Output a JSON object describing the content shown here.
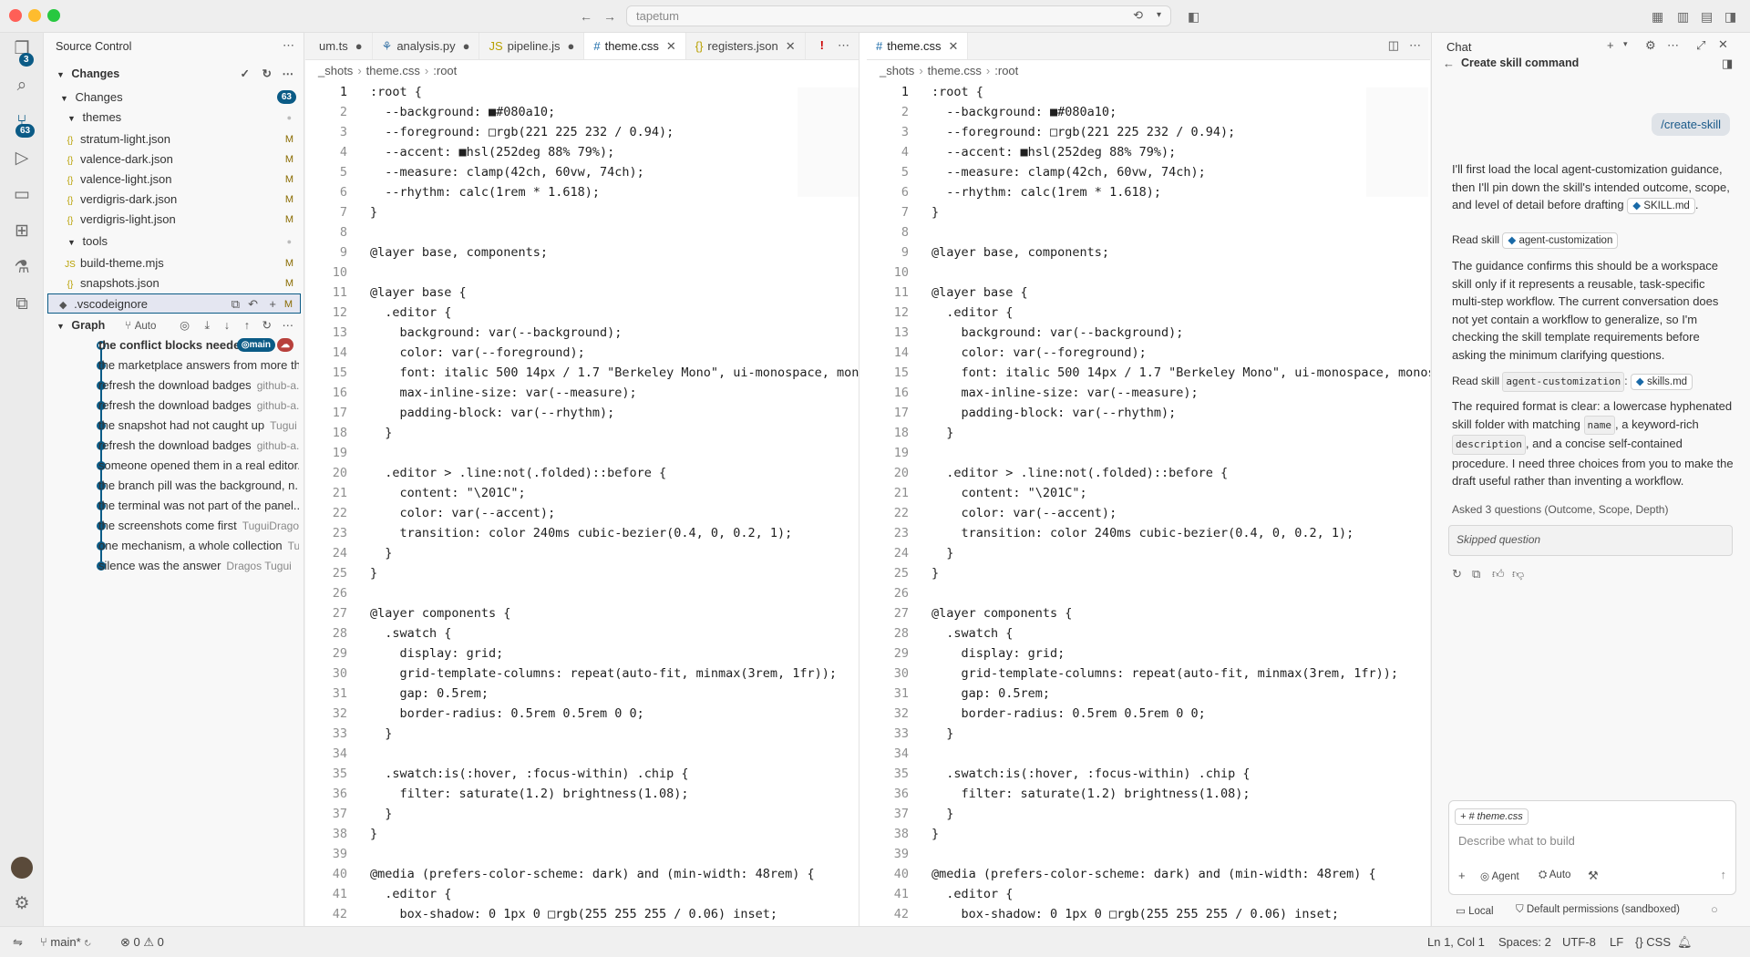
{
  "window": {
    "search_text": "tapetum"
  },
  "activity": {
    "scm_badge": "3",
    "graph_badge": "63"
  },
  "sidebar": {
    "title": "Source Control",
    "changes_section": "Changes",
    "changes_group": "Changes",
    "changes_count": "63",
    "folders": {
      "themes": "themes",
      "tools": "tools"
    },
    "files": [
      {
        "name": "stratum-light.json",
        "status": "M",
        "icon": "{}"
      },
      {
        "name": "valence-dark.json",
        "status": "M",
        "icon": "{}"
      },
      {
        "name": "valence-light.json",
        "status": "M",
        "icon": "{}"
      },
      {
        "name": "verdigris-dark.json",
        "status": "M",
        "icon": "{}"
      },
      {
        "name": "verdigris-light.json",
        "status": "M",
        "icon": "{}"
      }
    ],
    "tool_files": [
      {
        "name": "build-theme.mjs",
        "status": "M",
        "icon": "JS"
      },
      {
        "name": "snapshots.json",
        "status": "M",
        "icon": "{}"
      }
    ],
    "selected_file": {
      "name": ".vscodeignore",
      "status": "M"
    },
    "graph": {
      "title": "Graph",
      "mode": "Auto",
      "branch": "main",
      "commits": [
        {
          "message": "the conflict blocks neede...",
          "author": ""
        },
        {
          "message": "the marketplace answers from more th...",
          "author": ""
        },
        {
          "message": "refresh the download badges",
          "author": "github-a..."
        },
        {
          "message": "refresh the download badges",
          "author": "github-a..."
        },
        {
          "message": "the snapshot had not caught up",
          "author": "Tugui ..."
        },
        {
          "message": "refresh the download badges",
          "author": "github-a..."
        },
        {
          "message": "someone opened them in a real editor...",
          "author": ""
        },
        {
          "message": "the branch pill was the background, n...",
          "author": ""
        },
        {
          "message": "the terminal was not part of the panel...",
          "author": ""
        },
        {
          "message": "the screenshots come first",
          "author": "TuguiDragos"
        },
        {
          "message": "one mechanism, a whole collection",
          "author": "Tu..."
        },
        {
          "message": "silence was the answer",
          "author": "Dragos Tugui"
        }
      ]
    }
  },
  "editor_left": {
    "tabs": [
      {
        "label": "um.ts",
        "mark": "●"
      },
      {
        "label": "analysis.py",
        "mark": "●"
      },
      {
        "label": "pipeline.js",
        "mark": "●"
      },
      {
        "label": "theme.css",
        "mark": "✕"
      },
      {
        "label": "registers.json",
        "mark": "✕"
      }
    ],
    "breadcrumb": [
      "_shots",
      "theme.css",
      ":root"
    ]
  },
  "editor_right": {
    "tabs": [
      {
        "label": "theme.css",
        "mark": "✕"
      }
    ],
    "breadcrumb": [
      "_shots",
      "theme.css",
      ":root"
    ]
  },
  "code_lines": [
    ":root {",
    "  --background: ■#080a10;",
    "  --foreground: □rgb(221 225 232 / 0.94);",
    "  --accent: ■hsl(252deg 88% 79%);",
    "  --measure: clamp(42ch, 60vw, 74ch);",
    "  --rhythm: calc(1rem * 1.618);",
    "}",
    "",
    "@layer base, components;",
    "",
    "@layer base {",
    "  .editor {",
    "    background: var(--background);",
    "    color: var(--foreground);",
    "    font: italic 500 14px / 1.7 \"Berkeley Mono\", ui-monospace, monos",
    "    max-inline-size: var(--measure);",
    "    padding-block: var(--rhythm);",
    "  }",
    "",
    "  .editor > .line:not(.folded)::before {",
    "    content: \"\\201C\";",
    "    color: var(--accent);",
    "    transition: color 240ms cubic-bezier(0.4, 0, 0.2, 1);",
    "  }",
    "}",
    "",
    "@layer components {",
    "  .swatch {",
    "    display: grid;",
    "    grid-template-columns: repeat(auto-fit, minmax(3rem, 1fr));",
    "    gap: 0.5rem;",
    "    border-radius: 0.5rem 0.5rem 0 0;",
    "  }",
    "",
    "  .swatch:is(:hover, :focus-within) .chip {",
    "    filter: saturate(1.2) brightness(1.08);",
    "  }",
    "}",
    "",
    "@media (prefers-color-scheme: dark) and (min-width: 48rem) {",
    "  .editor {",
    "    box-shadow: 0 1px 0 □rgb(255 255 255 / 0.06) inset;"
  ],
  "chat": {
    "title": "Chat",
    "subtitle": "Create skill command",
    "user_message": "/create-skill",
    "p1": "I'll first load the local agent-customization guidance, then I'll pin down the skill's intended outcome, scope, and level of detail before drafting",
    "p1_chip": "SKILL.md",
    "read1_label": "Read skill",
    "read1_chip": "agent-customization",
    "p2": "The guidance confirms this should be a workspace skill only if it represents a reusable, task-specific multi-step workflow. The current conversation does not yet contain a workflow to generalize, so I'm checking the skill template requirements before asking the minimum clarifying questions.",
    "read2_label": "Read skill",
    "read2_code": "agent-customization",
    "read2_chip": "skills.md",
    "p3_a": "The required format is clear: a lowercase hyphenated skill folder with matching",
    "p3_code1": "name",
    "p3_b": ", a keyword-rich",
    "p3_code2": "description",
    "p3_c": ", and a concise self-contained procedure. I need three choices from you to make the draft useful rather than inventing a workflow.",
    "asked": "Asked 3 questions (Outcome, Scope, Depth)",
    "skipped": "Skipped question",
    "context_chip": "theme.css",
    "input_placeholder": "Describe what to build",
    "agent_label": "Agent",
    "auto_label": "Auto",
    "local_label": "Local",
    "permissions_label": "Default permissions (sandboxed)"
  },
  "status": {
    "branch": "main*",
    "errors": "0",
    "warnings": "0",
    "position": "Ln 1, Col 1",
    "spaces": "Spaces: 2",
    "encoding": "UTF-8",
    "eol": "LF",
    "language": "CSS"
  }
}
